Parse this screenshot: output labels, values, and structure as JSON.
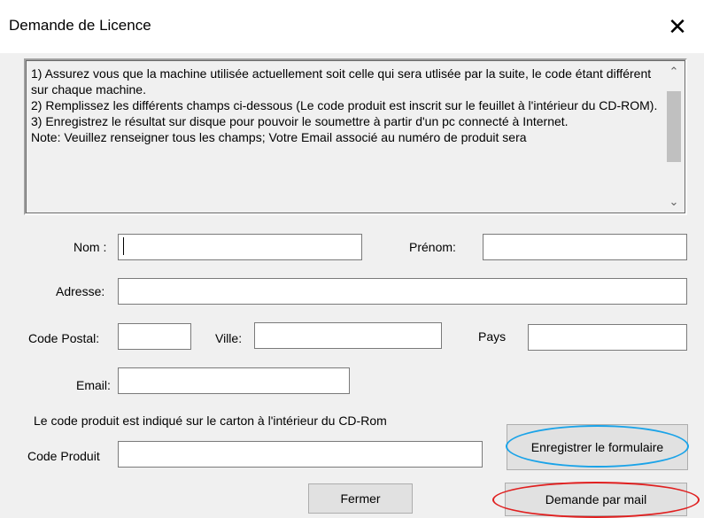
{
  "window": {
    "title": "Demande de Licence",
    "close_glyph": "✕"
  },
  "info": {
    "text": "1) Assurez vous que la machine utilisée actuellement soit celle qui sera utlisée par la suite, le code étant différent sur chaque machine.\n2) Remplissez les différents champs ci-dessous (Le code produit est inscrit sur le feuillet à l'intérieur du CD-ROM).\n3) Enregistrez le résultat sur disque pour pouvoir le soumettre à partir d'un pc connecté à Internet.\nNote: Veuillez renseigner tous les champs; Votre Email associé au numéro de produit sera",
    "scroll_up": "⌃",
    "scroll_down": "⌄"
  },
  "form": {
    "nom_label": "Nom :",
    "nom_value": "",
    "prenom_label": "Prénom:",
    "prenom_value": "",
    "adresse_label": "Adresse:",
    "adresse_value": "",
    "code_postal_label": "Code Postal:",
    "code_postal_value": "",
    "ville_label": "Ville:",
    "ville_value": "",
    "pays_label": "Pays",
    "pays_value": "",
    "email_label": "Email:",
    "email_value": "",
    "product_hint": "Le code produit est indiqué sur le carton à l'intérieur du CD-Rom",
    "code_produit_label": "Code Produit",
    "code_produit_value": ""
  },
  "buttons": {
    "save_label": "Enregistrer le formulaire",
    "close_label": "Fermer",
    "mail_label": "Demande par mail"
  },
  "annotation_colors": {
    "save_ring": "#1aa3e8",
    "mail_ring": "#e02020"
  }
}
